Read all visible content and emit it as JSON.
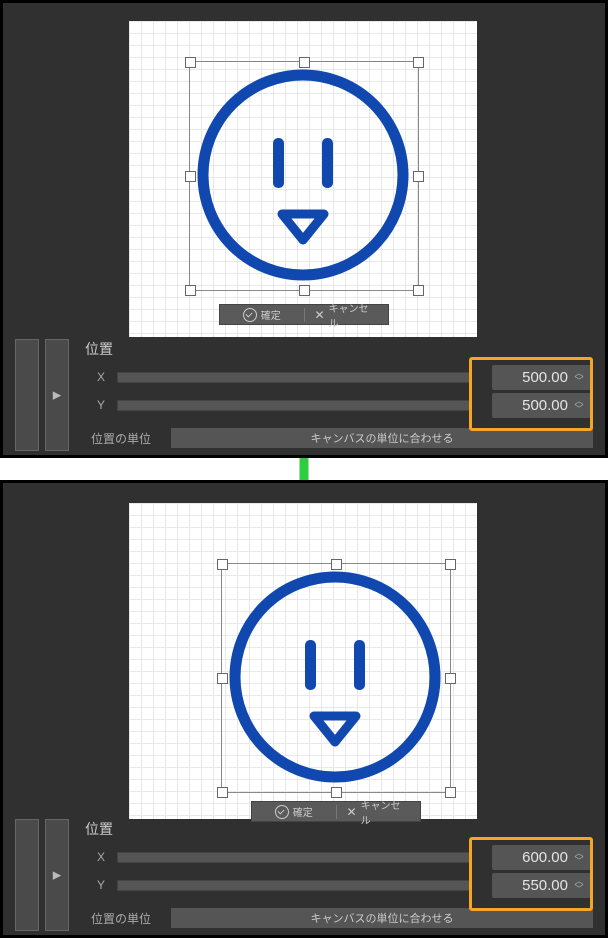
{
  "panel_title": "位置",
  "axis_x": "X",
  "axis_y": "Y",
  "confirm_label": "確定",
  "cancel_label": "キャンセル",
  "unit_label": "位置の単位",
  "unit_value": "キャンバスの単位に合わせる",
  "top": {
    "x": "500.00",
    "y": "500.00"
  },
  "bot": {
    "x": "600.00",
    "y": "550.00"
  }
}
